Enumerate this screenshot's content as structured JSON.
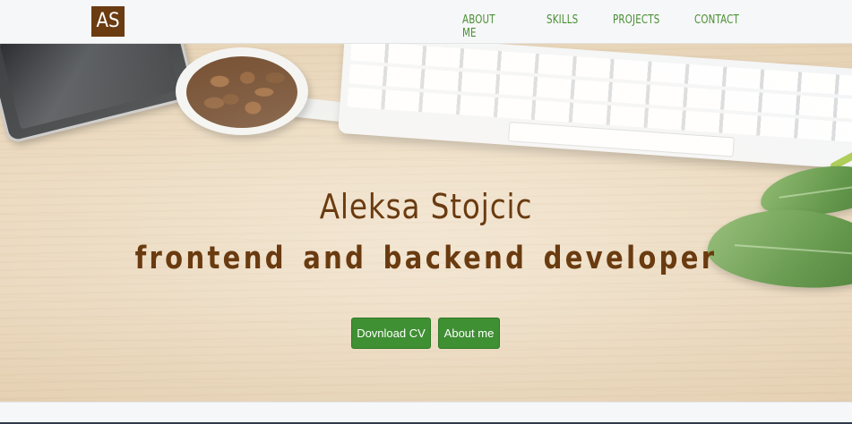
{
  "brand": {
    "logo_text": "AS",
    "logo_color": "#6b3b12"
  },
  "nav": {
    "links": [
      {
        "label": "ABOUT ME"
      },
      {
        "label": "SKILLS"
      },
      {
        "label": "PROJECTS"
      },
      {
        "label": "CONTACT"
      }
    ],
    "link_color": "#4a8f33"
  },
  "hero": {
    "name": "Aleksa Stojcic",
    "subtitle": "frontend and backend developer",
    "text_color": "#6a3b10",
    "background_image": "desk-with-phone-coffee-keyboard-plant",
    "buttons": [
      {
        "label": "Dovnload CV"
      },
      {
        "label": "About me"
      }
    ],
    "button_color": "#3f8f33"
  }
}
